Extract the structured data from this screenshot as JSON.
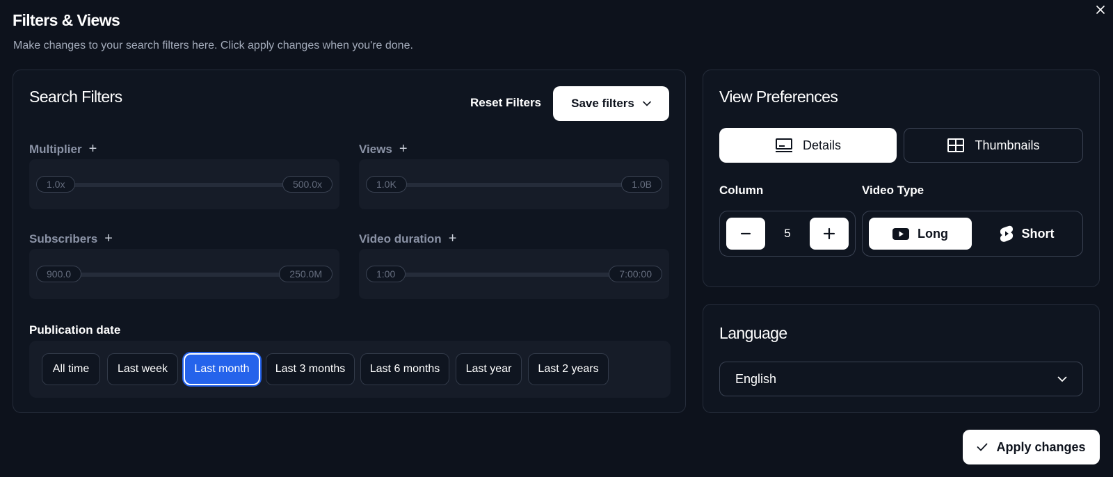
{
  "dialog": {
    "title": "Filters & Views",
    "subtitle": "Make changes to your search filters here. Click apply changes when you're done."
  },
  "search_filters": {
    "title": "Search Filters",
    "reset_label": "Reset Filters",
    "save_label": "Save filters",
    "multiplier": {
      "label": "Multiplier",
      "min": "1.0x",
      "max": "500.0x"
    },
    "views": {
      "label": "Views",
      "min": "1.0K",
      "max": "1.0B"
    },
    "subscribers": {
      "label": "Subscribers",
      "min": "900.0",
      "max": "250.0M"
    },
    "video_duration": {
      "label": "Video duration",
      "min": "1:00",
      "max": "7:00:00"
    },
    "publication_date": {
      "label": "Publication date",
      "options": [
        "All time",
        "Last week",
        "Last month",
        "Last 3 months",
        "Last 6 months",
        "Last year",
        "Last 2 years"
      ],
      "selected": "Last month"
    }
  },
  "view_preferences": {
    "title": "View Preferences",
    "details_label": "Details",
    "thumbnails_label": "Thumbnails",
    "selected_view": "Details",
    "column_label": "Column",
    "column_value": "5",
    "video_type_label": "Video Type",
    "long_label": "Long",
    "short_label": "Short",
    "selected_video_type": "Long"
  },
  "language": {
    "title": "Language",
    "value": "English"
  },
  "apply_label": "Apply changes",
  "colors": {
    "background": "#0d121c",
    "panel_border": "#252c3a",
    "accent": "#2563eb",
    "button_bg": "#ffffff"
  }
}
